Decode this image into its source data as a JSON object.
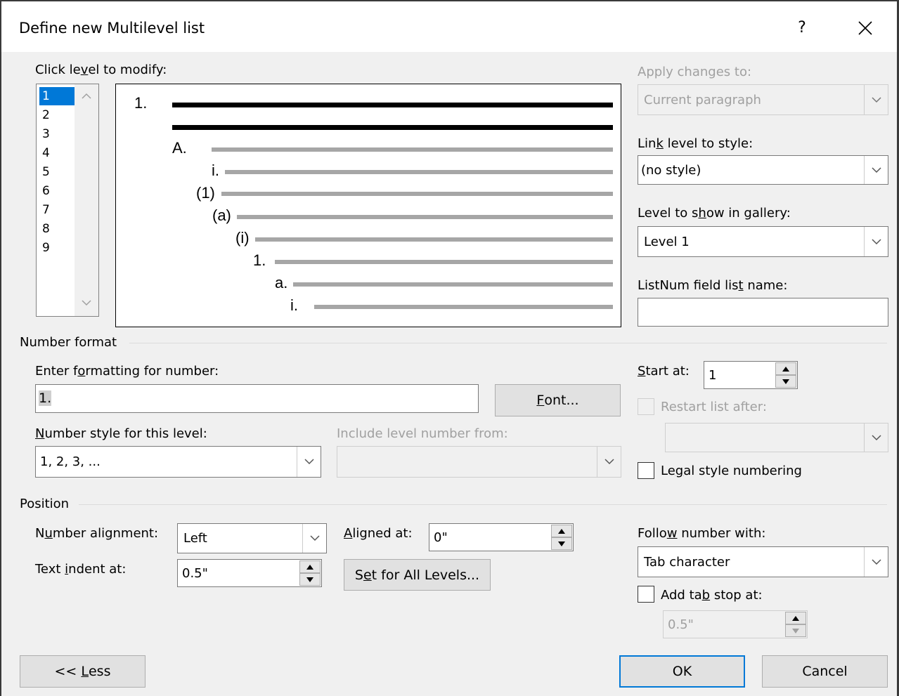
{
  "window": {
    "title": "Define new Multilevel list",
    "help_label": "?",
    "close_icon": "close-icon"
  },
  "levels": {
    "label_prefix": "Click le",
    "label_u": "v",
    "label_suffix": "el to modify:",
    "items": [
      "1",
      "2",
      "3",
      "4",
      "5",
      "6",
      "7",
      "8",
      "9"
    ],
    "selected": "1"
  },
  "preview": {
    "numbers": [
      "1.",
      "A.",
      "i.",
      "(1)",
      "(a)",
      "(i)",
      "1.",
      "a.",
      "i."
    ]
  },
  "apply_changes": {
    "label": "Apply changes to:",
    "value": "Current paragraph"
  },
  "link_level": {
    "label_prefix": "Lin",
    "label_u": "k",
    "label_suffix": " level to style:",
    "value": "(no style)"
  },
  "level_gallery": {
    "label_prefix": "Level to s",
    "label_u": "h",
    "label_suffix": "ow in gallery:",
    "value": "Level 1"
  },
  "listnum": {
    "label_prefix": "ListNum field lis",
    "label_u": "t",
    "label_suffix": " name:",
    "value": ""
  },
  "number_format": {
    "section": "Number format",
    "enter_label_prefix": "Enter f",
    "enter_label_u": "o",
    "enter_label_suffix": "rmatting for number:",
    "format_value": "1.",
    "font_button_u": "F",
    "font_button_rest": "ont...",
    "style_label_u": "N",
    "style_label_rest": "umber style for this level:",
    "style_value": "1, 2, 3, ...",
    "include_label": "Include level number from:",
    "include_value": "",
    "start_label_u": "S",
    "start_label_rest": "tart at:",
    "start_value": "1",
    "restart_label": "Restart list after:",
    "restart_value": "",
    "legal_label_prefix": "Le",
    "legal_label_u": "g",
    "legal_label_suffix": "al style numbering",
    "legal_checked": false
  },
  "position": {
    "section": "Position",
    "alignment_label_prefix": "N",
    "alignment_label_u": "u",
    "alignment_label_suffix": "mber alignment:",
    "alignment_value": "Left",
    "aligned_at_label_u": "A",
    "aligned_at_label_rest": "ligned at:",
    "aligned_at_value": "0\"",
    "indent_label_prefix": "Text ",
    "indent_label_u": "i",
    "indent_label_suffix": "ndent at:",
    "indent_value": "0.5\"",
    "set_all_prefix": "S",
    "set_all_u": "e",
    "set_all_suffix": "t for All Levels...",
    "follow_label_prefix": "Follo",
    "follow_label_u": "w",
    "follow_label_suffix": " number with:",
    "follow_value": "Tab character",
    "add_tab_prefix": "Add ta",
    "add_tab_u": "b",
    "add_tab_suffix": " stop at:",
    "add_tab_checked": false,
    "tab_stop_value": "0.5\""
  },
  "footer": {
    "less_prefix": "<< ",
    "less_u": "L",
    "less_rest": "ess",
    "ok": "OK",
    "cancel": "Cancel"
  }
}
